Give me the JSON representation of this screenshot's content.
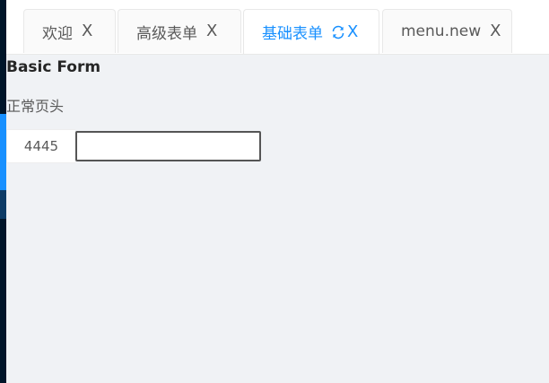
{
  "tabs": [
    {
      "label": "欢迎",
      "close": "X",
      "active": false
    },
    {
      "label": "高级表单",
      "close": "X",
      "active": false
    },
    {
      "label": "基础表单",
      "close": "X",
      "active": true,
      "icon": "reload-icon"
    },
    {
      "label": "menu.new",
      "close": "X",
      "active": false
    }
  ],
  "form": {
    "title": "Basic Form",
    "header_text": "正常页头",
    "addon_value": "4445",
    "input_value": ""
  },
  "colors": {
    "accent": "#1890ff",
    "sidebar": "#001529",
    "background": "#f0f2f5"
  }
}
